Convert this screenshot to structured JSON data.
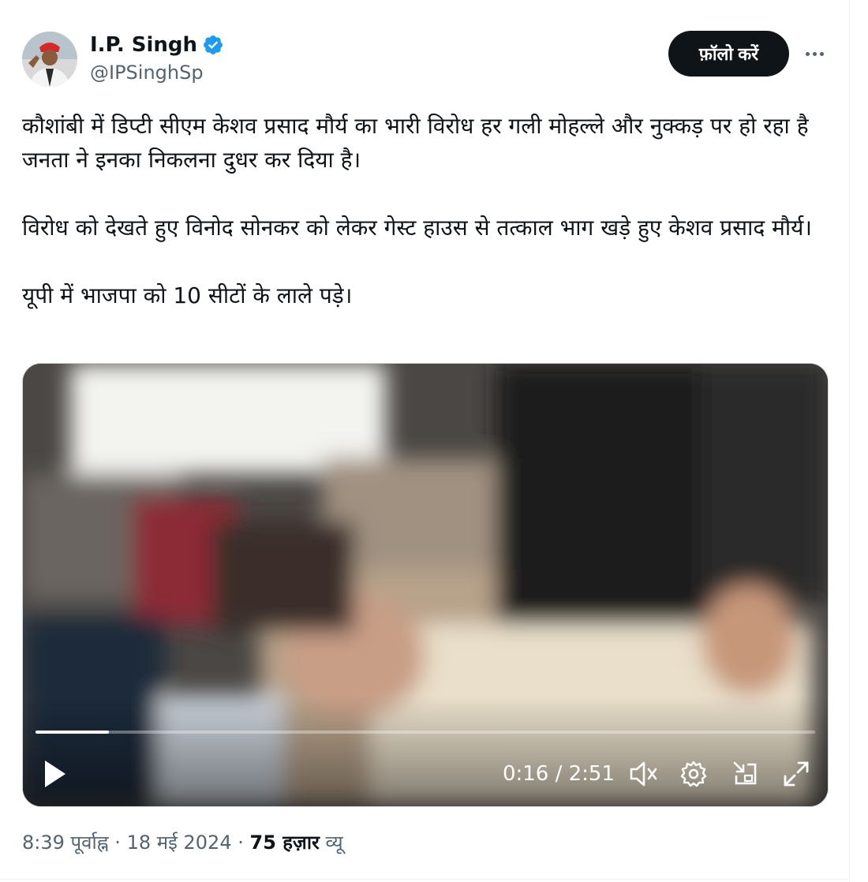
{
  "author": {
    "display_name": "I.P. Singh",
    "handle": "@IPSinghSp",
    "verified_color": "#1d9bf0"
  },
  "follow_label": "फ़ॉलो करें",
  "tweet": {
    "paragraphs": [
      "कौशांबी में डिप्टी सीएम केशव प्रसाद मौर्य का भारी विरोध हर गली मोहल्ले और नुक्कड़ पर हो रहा है जनता ने इनका निकलना दुधर कर दिया है।",
      "विरोध को देखते हुए विनोद सोनकर को लेकर गेस्ट हाउस से तत्काल भाग खड़े हुए केशव प्रसाद मौर्य।",
      "यूपी में भाजपा को 10 सीटों के लाले पड़े।"
    ]
  },
  "video": {
    "time_display": "0:16 / 2:51",
    "progress_fraction": 0.094,
    "icons": [
      "play-icon",
      "mute-icon",
      "settings-icon",
      "pip-icon",
      "fullscreen-icon"
    ]
  },
  "meta": {
    "time": "8:39 पूर्वाह्न",
    "separator": "·",
    "date": "18 मई 2024",
    "views_count": "75 हज़ार",
    "views_label": "व्यू"
  },
  "colors": {
    "text": "#0f1419",
    "secondary": "#536471",
    "accent": "#1d9bf0",
    "button_bg": "#0f1419"
  }
}
